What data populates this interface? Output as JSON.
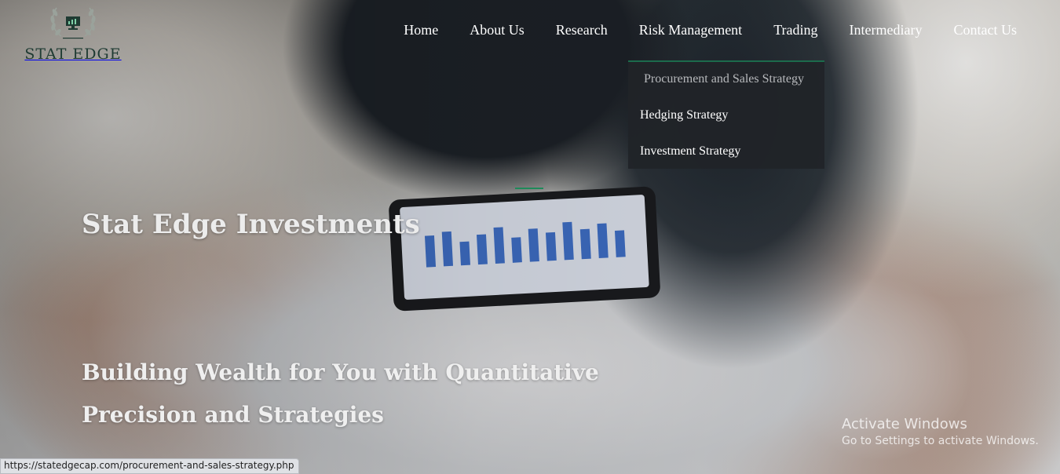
{
  "logo": {
    "name": "STAT EDGE",
    "icon": "laurel-monitor-icon",
    "colors": {
      "brand": "#1f3b33"
    }
  },
  "nav": {
    "items": [
      {
        "label": "Home"
      },
      {
        "label": "About Us"
      },
      {
        "label": "Research"
      },
      {
        "label": "Risk Management"
      },
      {
        "label": "Trading"
      },
      {
        "label": "Intermediary"
      },
      {
        "label": "Contact Us"
      }
    ],
    "dropdown": {
      "parent": "Risk Management",
      "items": [
        {
          "label": "Procurement and Sales Strategy",
          "hovered": true
        },
        {
          "label": "Hedging Strategy"
        },
        {
          "label": "Investment Strategy"
        }
      ]
    }
  },
  "hero": {
    "title": "Stat Edge Investments",
    "subtitle": "Building Wealth for You with Quantitative Precision and Strategies",
    "accent_color": "#1e8a5a"
  },
  "status_bar": {
    "url": "https://statedgecap.com/procurement-and-sales-strategy.php"
  },
  "watermark": {
    "line1": "Activate Windows",
    "line2": "Go to Settings to activate Windows."
  }
}
